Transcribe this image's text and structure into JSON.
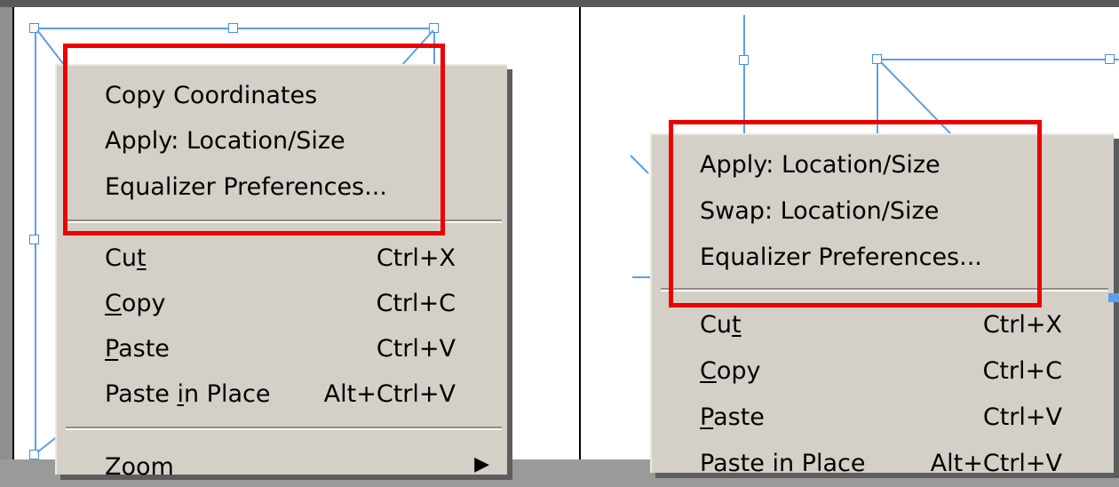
{
  "left_menu": {
    "equalizer_items": [
      {
        "label": "Copy Coordinates"
      },
      {
        "label": "Apply: Location/Size"
      },
      {
        "label": "Equalizer Preferences..."
      }
    ],
    "edit_items": [
      {
        "label_pre": "Cu",
        "label_ul": "t",
        "label_post": "",
        "shortcut": "Ctrl+X"
      },
      {
        "label_pre": "",
        "label_ul": "C",
        "label_post": "opy",
        "shortcut": "Ctrl+C"
      },
      {
        "label_pre": "",
        "label_ul": "P",
        "label_post": "aste",
        "shortcut": "Ctrl+V"
      },
      {
        "label_pre": "Paste ",
        "label_ul": "i",
        "label_post": "n Place",
        "shortcut": "Alt+Ctrl+V"
      }
    ],
    "zoom_label": "Zoom",
    "zoom_arrow_icon": "submenu-arrow-icon"
  },
  "right_menu": {
    "equalizer_items": [
      {
        "label": "Apply: Location/Size"
      },
      {
        "label": "Swap: Location/Size"
      },
      {
        "label": "Equalizer Preferences..."
      }
    ],
    "edit_items": [
      {
        "label_pre": "Cu",
        "label_ul": "t",
        "label_post": "",
        "shortcut": "Ctrl+X"
      },
      {
        "label_pre": "",
        "label_ul": "C",
        "label_post": "opy",
        "shortcut": "Ctrl+C"
      },
      {
        "label_pre": "",
        "label_ul": "P",
        "label_post": "aste",
        "shortcut": "Ctrl+V"
      },
      {
        "label_pre": "Paste in Place",
        "label_ul": "",
        "label_post": "",
        "shortcut": "Alt+Ctrl+V"
      }
    ]
  },
  "colors": {
    "menu_bg": "#d4d0c8",
    "highlight": "#ee0000",
    "selection": "#5b9ef0"
  }
}
